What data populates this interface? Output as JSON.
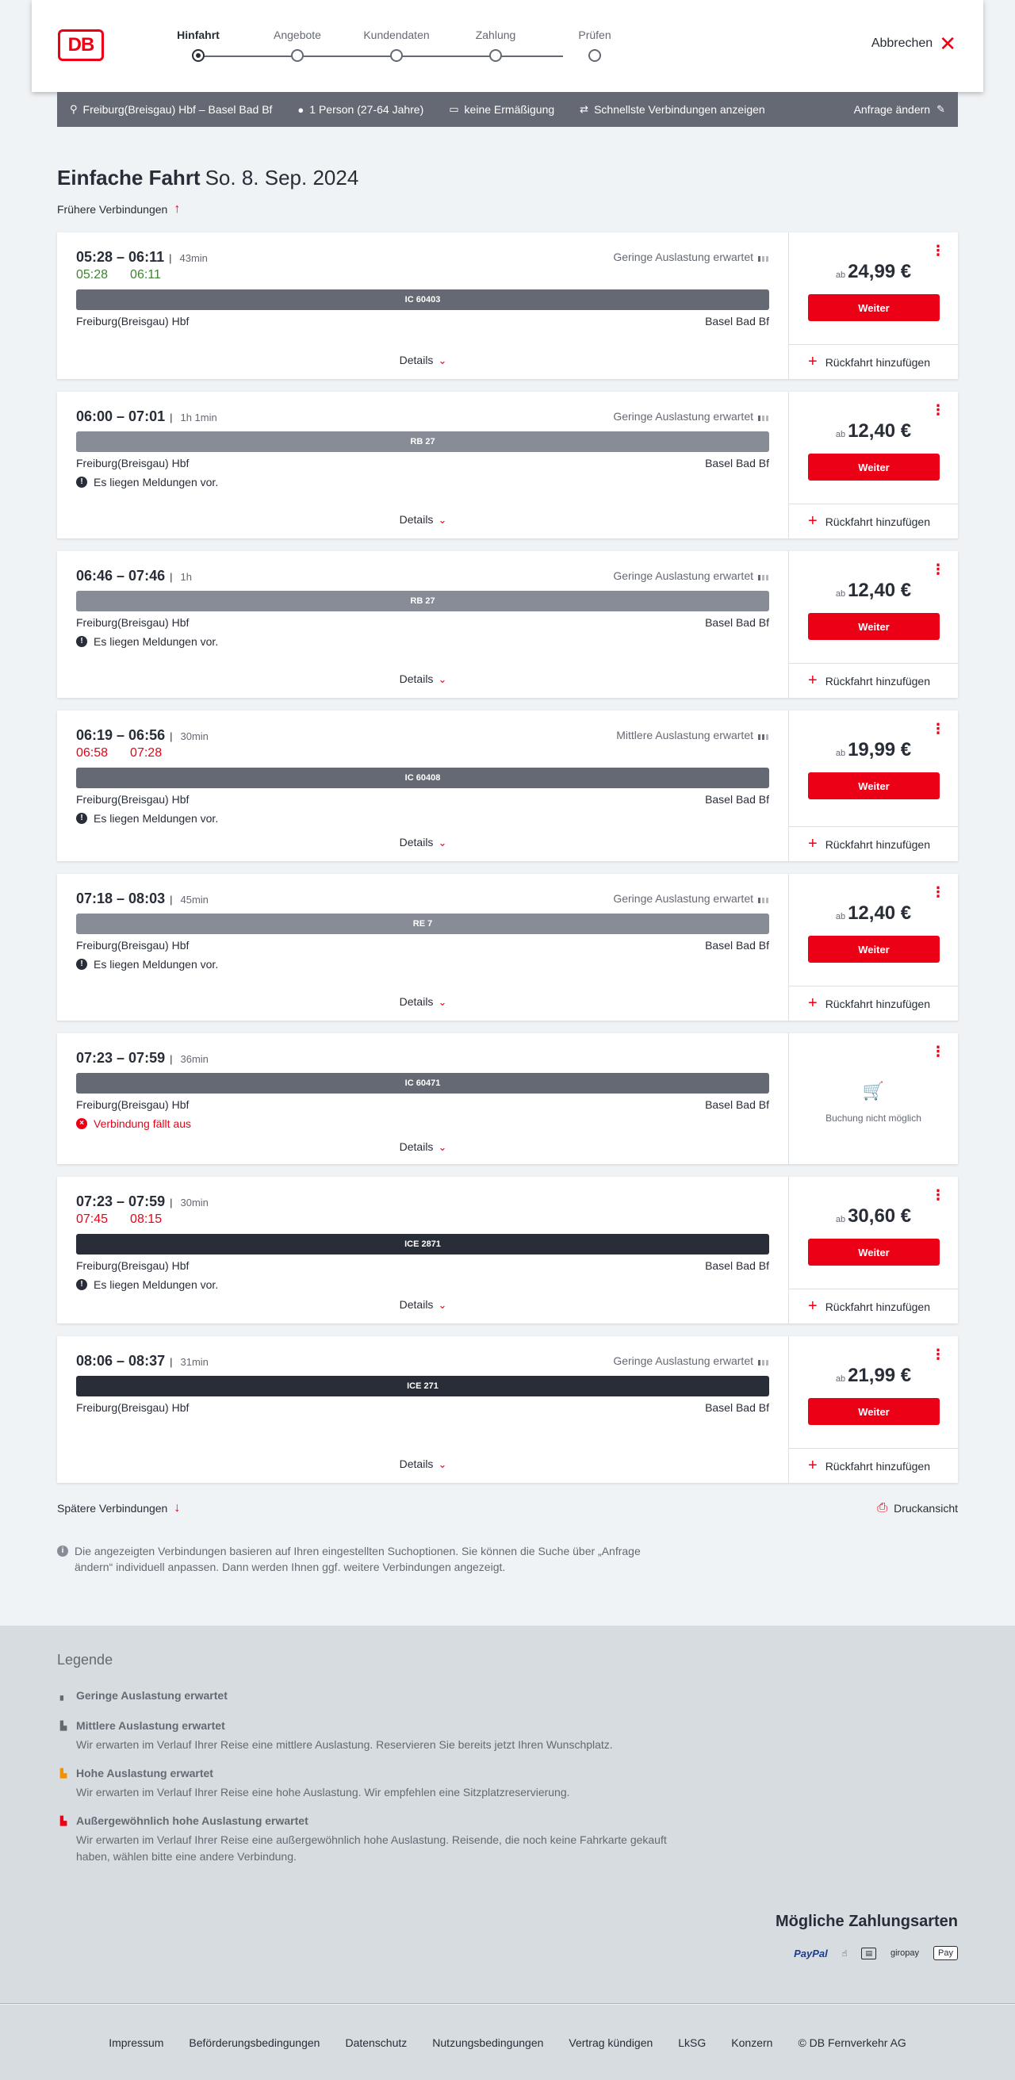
{
  "header": {
    "logo": "DB",
    "steps": [
      "Hinfahrt",
      "Angebote",
      "Kundendaten",
      "Zahlung",
      "Prüfen"
    ],
    "cancel_label": "Abbrechen"
  },
  "query": {
    "route": "Freiburg(Breisgau) Hbf – Basel Bad Bf",
    "passengers": "1 Person (27-64 Jahre)",
    "discount": "keine Ermäßigung",
    "fastest": "Schnellste Verbindungen anzeigen",
    "edit": "Anfrage ändern"
  },
  "main": {
    "title_bold": "Einfache Fahrt",
    "title_date": "So. 8. Sep. 2024",
    "earlier": "Frühere Verbindungen",
    "later": "Spätere Verbindungen",
    "print": "Druckansicht",
    "note": "Die angezeigten Verbindungen basieren auf Ihren eingestellten Suchoptionen. Sie können die Suche über „Anfrage ändern“ individuell anpassen. Dann werden Ihnen ggf. weitere Verbindungen angezeigt."
  },
  "labels": {
    "details": "Details",
    "weiter": "Weiter",
    "return": "Rückfahrt hinzufügen",
    "ab": "ab",
    "no_booking": "Buchung nicht möglich"
  },
  "connections": [
    {
      "times": "05:28 – 06:11",
      "duration": "43min",
      "load": "Geringe Auslastung erwartet",
      "rt": [
        "05:28",
        "06:11"
      ],
      "rt_status": "ok",
      "train": "IC 60403",
      "from": "Freiburg(Breisgau) Hbf",
      "to": "Basel Bad Bf",
      "message": "",
      "price": "24,99 €"
    },
    {
      "times": "06:00 – 07:01",
      "duration": "1h 1min",
      "load": "Geringe Auslastung erwartet",
      "rt": [],
      "rt_status": "",
      "train": "RB 27",
      "from": "Freiburg(Breisgau) Hbf",
      "to": "Basel Bad Bf",
      "message": "Es liegen Meldungen vor.",
      "price": "12,40 €"
    },
    {
      "times": "06:46 – 07:46",
      "duration": "1h",
      "load": "Geringe Auslastung erwartet",
      "rt": [],
      "rt_status": "",
      "train": "RB 27",
      "from": "Freiburg(Breisgau) Hbf",
      "to": "Basel Bad Bf",
      "message": "Es liegen Meldungen vor.",
      "price": "12,40 €"
    },
    {
      "times": "06:19 – 06:56",
      "duration": "30min",
      "load": "Mittlere Auslastung erwartet",
      "rt": [
        "06:58",
        "07:28"
      ],
      "rt_status": "late",
      "train": "IC 60408",
      "from": "Freiburg(Breisgau) Hbf",
      "to": "Basel Bad Bf",
      "message": "Es liegen Meldungen vor.",
      "price": "19,99 €"
    },
    {
      "times": "07:18 – 08:03",
      "duration": "45min",
      "load": "Geringe Auslastung erwartet",
      "rt": [],
      "rt_status": "",
      "train": "RE 7",
      "from": "Freiburg(Breisgau) Hbf",
      "to": "Basel Bad Bf",
      "message": "Es liegen Meldungen vor.",
      "price": "12,40 €"
    },
    {
      "times": "07:23 – 07:59",
      "duration": "36min",
      "load": "",
      "rt": [],
      "rt_status": "",
      "train": "IC 60471",
      "from": "Freiburg(Breisgau) Hbf",
      "to": "Basel Bad Bf",
      "message": "Verbindung fällt aus",
      "price": ""
    },
    {
      "times": "07:23 – 07:59",
      "duration": "30min",
      "load": "",
      "rt": [
        "07:45",
        "08:15"
      ],
      "rt_status": "late",
      "train": "ICE 2871",
      "from": "Freiburg(Breisgau) Hbf",
      "to": "Basel Bad Bf",
      "message": "Es liegen Meldungen vor.",
      "price": "30,60 €"
    },
    {
      "times": "08:06 – 08:37",
      "duration": "31min",
      "load": "Geringe Auslastung erwartet",
      "rt": [],
      "rt_status": "",
      "train": "ICE 271",
      "from": "Freiburg(Breisgau) Hbf",
      "to": "Basel Bad Bf",
      "message": "",
      "price": "21,99 €"
    }
  ],
  "legend": {
    "title": "Legende",
    "items": [
      {
        "title": "Geringe Auslastung erwartet",
        "desc": ""
      },
      {
        "title": "Mittlere Auslastung erwartet",
        "desc": "Wir erwarten im Verlauf Ihrer Reise eine mittlere Auslastung. Reservieren Sie bereits jetzt Ihren Wunschplatz."
      },
      {
        "title": "Hohe Auslastung erwartet",
        "desc": "Wir erwarten im Verlauf Ihrer Reise eine hohe Auslastung. Wir empfehlen eine Sitzplatzreservierung."
      },
      {
        "title": "Außergewöhnlich hohe Auslastung erwartet",
        "desc": "Wir erwarten im Verlauf Ihrer Reise eine außergewöhnlich hohe Auslastung. Reisende, die noch keine Fahrkarte gekauft haben, wählen bitte eine andere Verbindung."
      }
    ]
  },
  "payment": {
    "title": "Mögliche Zahlungsarten",
    "methods": [
      "PayPal",
      "giropay",
      "Pay"
    ]
  },
  "footer": [
    "Impressum",
    "Beförderungsbedingungen",
    "Datenschutz",
    "Nutzungsbedingungen",
    "Vertrag kündigen",
    "LkSG",
    "Konzern",
    "© DB Fernverkehr AG"
  ],
  "colors": {
    "brand": "#ec0016",
    "ok": "#408335",
    "late": "#ec0016",
    "ic": "#646973",
    "regional": "#878c96",
    "ice": "#282d37"
  }
}
